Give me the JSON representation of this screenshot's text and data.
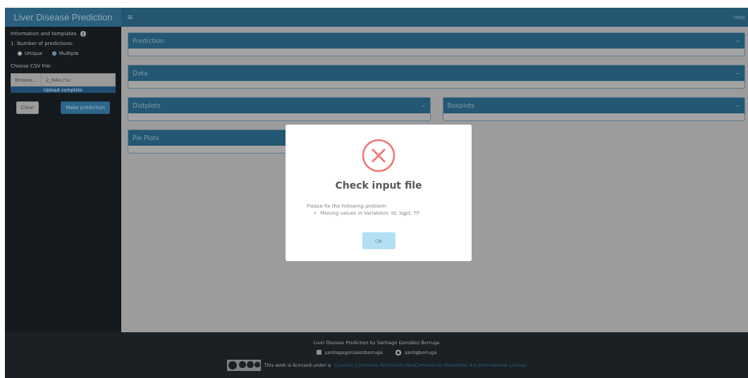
{
  "header": {
    "title": "Liver Disease Prediction",
    "menu_glyph": "≡",
    "help": "Help"
  },
  "sidebar": {
    "info_label": "Information and templates",
    "question": "1. Number of predictions:",
    "options": [
      {
        "label": "Unique",
        "selected": false
      },
      {
        "label": "Multiple",
        "selected": true
      }
    ],
    "file_label": "Choose CSV File:",
    "browse": "Browse...",
    "file_name": "2_NAs.csv",
    "progress": "Upload complete",
    "level": 1,
    "clear": "Clear",
    "predict": "Make prediction"
  },
  "rows": [
    [
      {
        "title": "Prediction",
        "collapse": "−"
      }
    ],
    [
      {
        "title": "Data",
        "collapse": "−"
      }
    ],
    [
      {
        "title": "Distplots",
        "collapse": "−"
      },
      {
        "title": "Boxplots",
        "collapse": "−"
      }
    ],
    [
      {
        "title": "Pie Plots"
      }
    ]
  ],
  "modal": {
    "title": "Check input file",
    "intro": "Please fix the following problem:",
    "bullet": "•",
    "items": [
      "Missing values in Variable/s: Id, Sgpt, TP."
    ],
    "ok": "Ok"
  },
  "footer": {
    "credit": "Liver Disease Prediction by Santiago González Berruga",
    "linkedin": "santiagogonzalezberruga",
    "github": "santigberruga",
    "license_prefix": "This work is licensed under a",
    "license_link": "Creative Commons Attribution-NonCommercial-ShareAlike 4.0 International License"
  }
}
